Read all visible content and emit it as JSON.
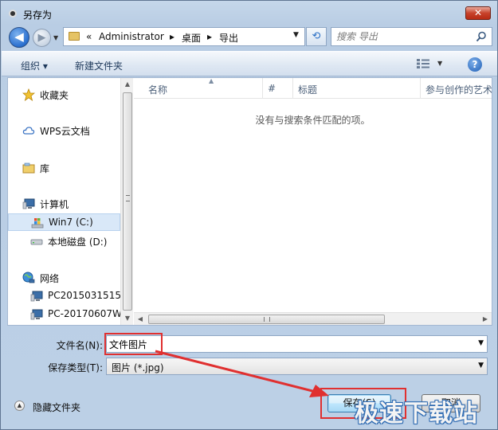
{
  "window": {
    "title": "另存为",
    "close_symbol": "✕"
  },
  "navigation": {
    "back_symbol": "◀",
    "forward_symbol": "▶",
    "address": {
      "overflow": "«",
      "segments": [
        "Administrator",
        "桌面",
        "导出"
      ],
      "separator": "▸"
    },
    "search_placeholder": "搜索 导出"
  },
  "toolbar": {
    "organize": "组织 ▾",
    "new_folder": "新建文件夹",
    "help": "?"
  },
  "nav_pane": {
    "items": [
      {
        "label": "收藏夹",
        "icon": "star-icon"
      },
      {
        "label": "WPS云文档",
        "icon": "cloud-icon"
      },
      {
        "label": "库",
        "icon": "library-icon"
      },
      {
        "label": "计算机",
        "icon": "computer-icon"
      },
      {
        "label": "Win7 (C:)",
        "icon": "windows-drive-icon"
      },
      {
        "label": "本地磁盘 (D:)",
        "icon": "drive-icon"
      },
      {
        "label": "网络",
        "icon": "network-icon"
      },
      {
        "label": "PC2015031515",
        "icon": "network-computer-icon"
      },
      {
        "label": "PC-20170607W",
        "icon": "network-computer-icon"
      }
    ]
  },
  "file_list": {
    "columns": [
      "名称",
      "#",
      "标题",
      "参与创作的艺术"
    ],
    "empty_message": "没有与搜索条件匹配的项。"
  },
  "form": {
    "filename_label": "文件名(N):",
    "filename_value": "文件图片",
    "type_label": "保存类型(T):",
    "type_value": "图片 (*.jpg)"
  },
  "footer": {
    "hide_folders": "隐藏文件夹",
    "save": "保存(S)",
    "cancel": "取消"
  },
  "watermark": "极速下载站",
  "colors": {
    "annotation": "#e03030",
    "accent": "#2a6fcf"
  }
}
